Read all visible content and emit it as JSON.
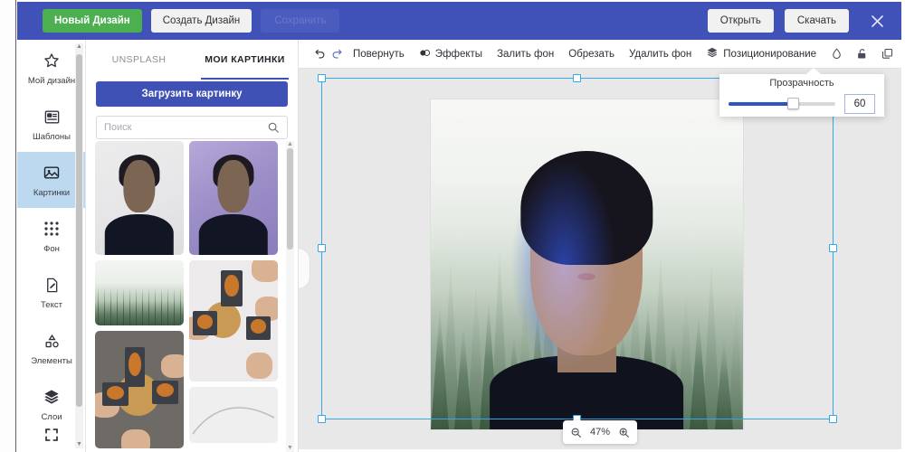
{
  "header": {
    "new_design_label": "Новый Дизайн",
    "create_design_label": "Создать Дизайн",
    "save_label": "Сохранить",
    "open_label": "Открыть",
    "download_label": "Скачать",
    "close_label": "✕",
    "accent_color": "#4052b8",
    "new_design_color": "#4caf50"
  },
  "rail": {
    "items": [
      {
        "label": "Мой дизайн",
        "icon": "star-icon"
      },
      {
        "label": "Шаблоны",
        "icon": "templates-icon"
      },
      {
        "label": "Картинки",
        "icon": "image-icon"
      },
      {
        "label": "Фон",
        "icon": "dots-grid-icon"
      },
      {
        "label": "Текст",
        "icon": "text-icon"
      },
      {
        "label": "Элементы",
        "icon": "shapes-icon"
      },
      {
        "label": "Слои",
        "icon": "layers-icon"
      }
    ],
    "active_index": 2,
    "bottom_icon": "fullscreen-icon"
  },
  "panel": {
    "tabs": [
      {
        "label": "UNSPLASH",
        "active": false
      },
      {
        "label": "МОИ КАРТИНКИ",
        "active": true
      }
    ],
    "upload_label": "Загрузить картинку",
    "search": {
      "value": "",
      "placeholder": "Поиск",
      "icon": "search-icon"
    },
    "thumbnails": [
      {
        "name": "portrait-plain-bg",
        "kind": "portrait-a"
      },
      {
        "name": "portrait-purple-bg",
        "kind": "portrait-b"
      },
      {
        "name": "forest-landscape",
        "kind": "forest"
      },
      {
        "name": "pizza-phones-light",
        "kind": "pizza-light"
      },
      {
        "name": "pizza-phones-dark",
        "kind": "pizza-dark"
      },
      {
        "name": "line-curve-graphic",
        "kind": "curve"
      }
    ]
  },
  "toolbar": {
    "undo_icon": "undo-icon",
    "redo_icon": "redo-icon",
    "rotate_label": "Повернуть",
    "effects_label": "Эффекты",
    "effects_icon": "contrast-icon",
    "fill_bg_label": "Залить фон",
    "crop_label": "Обрезать",
    "remove_bg_label": "Удалить фон",
    "positioning_label": "Позиционирование",
    "positioning_icon": "layers-icon",
    "transparency_icon": "droplet-icon",
    "lock_icon": "unlock-icon",
    "duplicate_icon": "duplicate-icon",
    "delete_icon": "trash-icon"
  },
  "transparency": {
    "title": "Прозрачность",
    "value": "60",
    "percent": 60,
    "fill_color": "#2f55c4"
  },
  "canvas": {
    "zoom_label": "47%",
    "zoom_out_icon": "zoom-out-icon",
    "zoom_in_icon": "zoom-in-icon",
    "selection_color": "#35a8e8",
    "collapse_handle": "panel-collapse-handle",
    "artboard_name": "portrait-over-forest-composition"
  }
}
